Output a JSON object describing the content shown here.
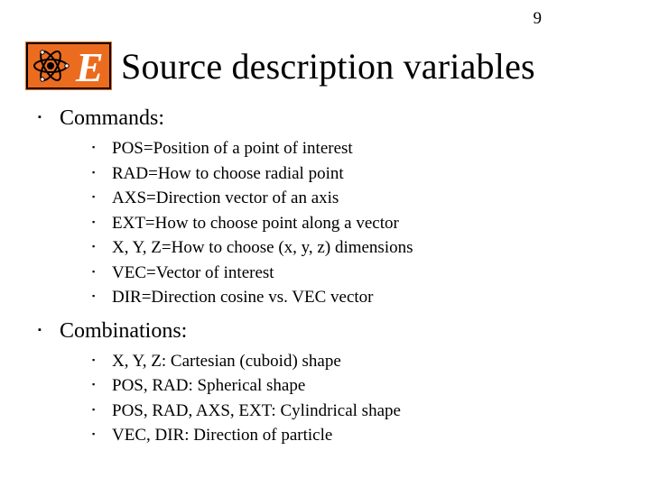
{
  "page_number": "9",
  "title": "Source description variables",
  "sections": [
    {
      "heading": "Commands:",
      "items": [
        "POS=Position of a point of interest",
        "RAD=How to choose radial point",
        "AXS=Direction vector of an axis",
        "EXT=How to choose point along a vector",
        "X, Y, Z=How to choose (x, y, z) dimensions",
        "VEC=Vector of interest",
        "DIR=Direction cosine vs. VEC vector"
      ]
    },
    {
      "heading": "Combinations:",
      "items": [
        "X, Y, Z: Cartesian (cuboid) shape",
        "POS, RAD: Spherical shape",
        "POS, RAD, AXS, EXT: Cylindrical shape",
        "VEC, DIR: Direction of particle"
      ]
    }
  ]
}
